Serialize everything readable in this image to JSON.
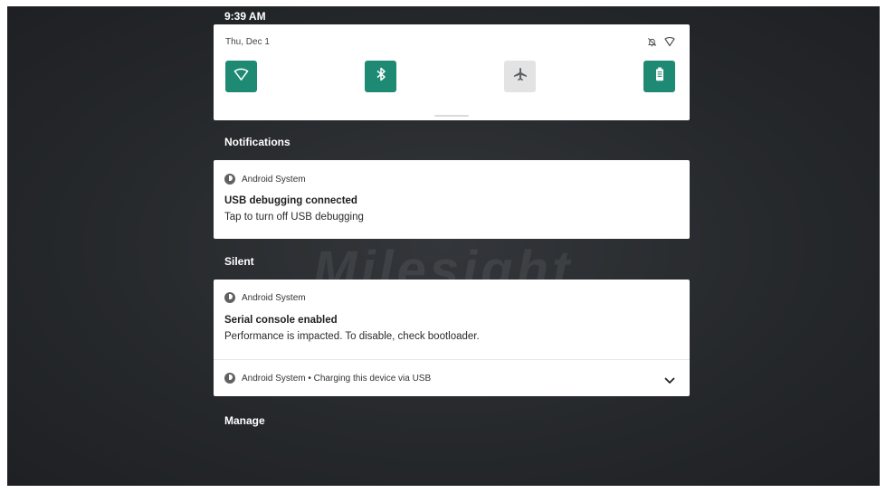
{
  "status_bar": {
    "time": "9:39 AM"
  },
  "quick_settings": {
    "date": "Thu, Dec 1",
    "status_icons": [
      "do-not-disturb-off-icon",
      "wifi-icon"
    ],
    "tiles": [
      {
        "name": "wifi",
        "icon": "wifi-icon",
        "state": "on"
      },
      {
        "name": "bluetooth",
        "icon": "bluetooth-icon",
        "state": "on"
      },
      {
        "name": "airplane-mode",
        "icon": "airplane-icon",
        "state": "off"
      },
      {
        "name": "battery-saver",
        "icon": "battery-saver-icon",
        "state": "on"
      }
    ],
    "accent_color": "#1f8a73",
    "off_color": "#e3e3e3"
  },
  "sections": {
    "notifications_title": "Notifications",
    "silent_title": "Silent",
    "manage_label": "Manage"
  },
  "notifications": [
    {
      "app": "Android System",
      "title": "USB debugging connected",
      "text": "Tap to turn off USB debugging"
    }
  ],
  "silent_notifications": [
    {
      "app": "Android System",
      "title": "Serial console enabled",
      "text": "Performance is impacted. To disable, check bootloader."
    },
    {
      "summary": "Android System • Charging this device via USB"
    }
  ],
  "background": {
    "watermark": "Milesight"
  }
}
